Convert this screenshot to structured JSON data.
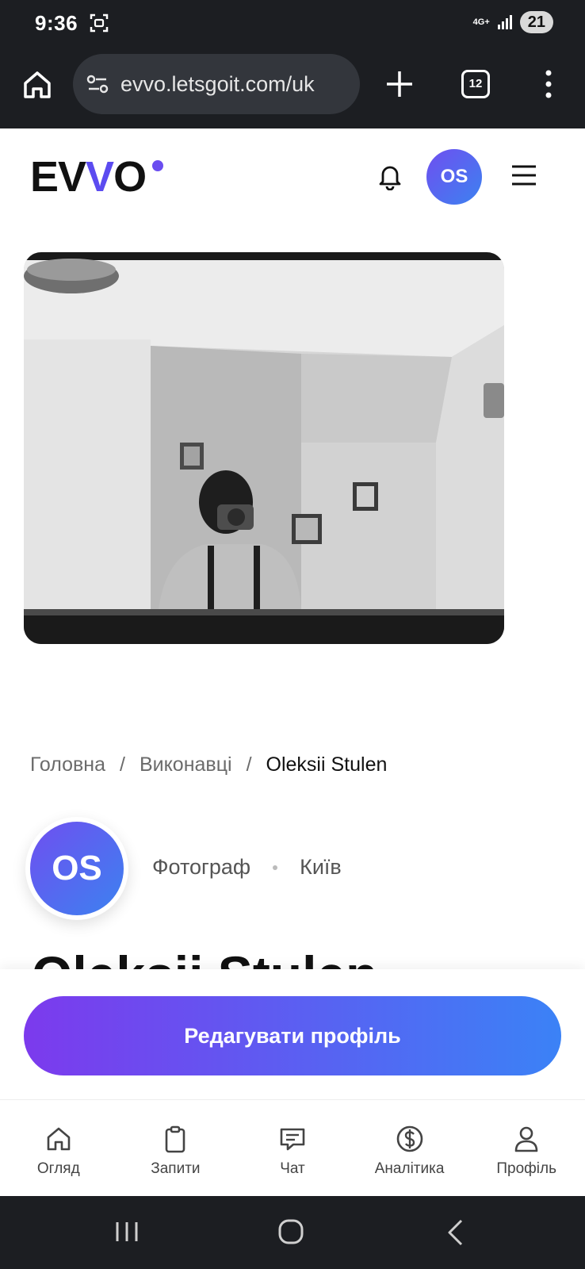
{
  "status_bar": {
    "time": "9:36",
    "network": "4G+",
    "battery": "21"
  },
  "browser": {
    "url": "evvo.letsgoit.com/uk",
    "tab_count": "12"
  },
  "header": {
    "logo_prefix": "EV",
    "logo_v": "V",
    "logo_suffix": "O",
    "avatar_initials": "OS"
  },
  "breadcrumb": {
    "home": "Головна",
    "separator": "/",
    "section": "Виконавці",
    "current": "Oleksii Stulen"
  },
  "profile": {
    "initials": "OS",
    "role": "Фотограф",
    "city": "Київ",
    "name": "Oleksii Stulen"
  },
  "actions": {
    "edit_profile": "Редагувати профіль"
  },
  "bottom_nav": {
    "items": [
      {
        "label": "Огляд",
        "icon": "home-icon"
      },
      {
        "label": "Запити",
        "icon": "clipboard-icon"
      },
      {
        "label": "Чат",
        "icon": "chat-icon"
      },
      {
        "label": "Аналітика",
        "icon": "dollar-icon"
      },
      {
        "label": "Профіль",
        "icon": "user-icon"
      }
    ]
  },
  "colors": {
    "accent_start": "#7c3aed",
    "accent_end": "#3b82f6",
    "dark_bar": "#1c1e22"
  }
}
